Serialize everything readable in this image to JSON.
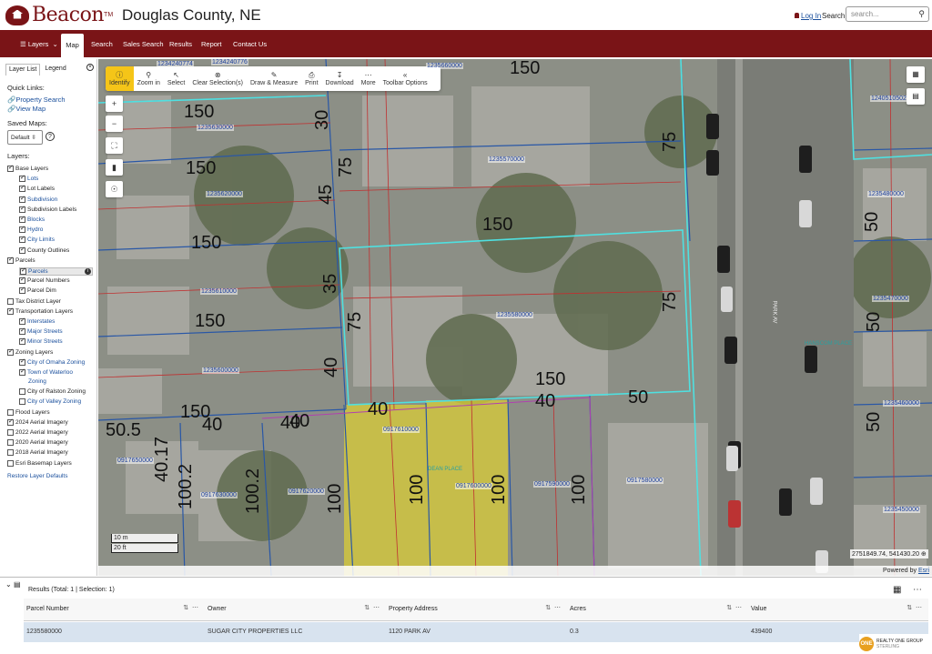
{
  "header": {
    "brand": "Beacon",
    "tm": "TM",
    "county": "Douglas County, NE",
    "login": "Log In",
    "search_link": "Search",
    "search_placeholder": "search..."
  },
  "nav": {
    "layers": "Layers",
    "map": "Map",
    "search": "Search",
    "sales_search": "Sales Search",
    "results": "Results",
    "report": "Report",
    "contact": "Contact Us"
  },
  "sidebar": {
    "tab_layer_list": "Layer List",
    "tab_legend": "Legend",
    "quick_links": "Quick Links:",
    "property_search": "Property Search",
    "view_map": "View Map",
    "saved_maps": "Saved Maps:",
    "saved_default": "Default",
    "layers_heading": "Layers:",
    "restore": "Restore Layer Defaults",
    "layers": [
      {
        "label": "Base Layers",
        "checked": true,
        "indent": 0,
        "link": false
      },
      {
        "label": "Lots",
        "checked": true,
        "indent": 1,
        "link": true
      },
      {
        "label": "Lot Labels",
        "checked": true,
        "indent": 1,
        "link": false
      },
      {
        "label": "Subdivision",
        "checked": true,
        "indent": 1,
        "link": true
      },
      {
        "label": "Subdivision Labels",
        "checked": true,
        "indent": 1,
        "link": false
      },
      {
        "label": "Blocks",
        "checked": true,
        "indent": 1,
        "link": true
      },
      {
        "label": "Hydro",
        "checked": true,
        "indent": 1,
        "link": true
      },
      {
        "label": "City Limits",
        "checked": true,
        "indent": 1,
        "link": true
      },
      {
        "label": "County Outlines",
        "checked": true,
        "indent": 1,
        "link": false
      },
      {
        "label": "Parcels",
        "checked": true,
        "indent": 0,
        "link": false
      },
      {
        "label": "Parcels",
        "checked": true,
        "indent": 1,
        "link": true,
        "highlight": true
      },
      {
        "label": "Parcel Numbers",
        "checked": true,
        "indent": 1,
        "link": false
      },
      {
        "label": "Parcel Dim",
        "checked": true,
        "indent": 1,
        "link": false
      },
      {
        "label": "Tax District Layer",
        "checked": false,
        "indent": 0,
        "link": false
      },
      {
        "label": "Transportation Layers",
        "checked": true,
        "indent": 0,
        "link": false
      },
      {
        "label": "Interstates",
        "checked": true,
        "indent": 1,
        "link": true
      },
      {
        "label": "Major Streets",
        "checked": true,
        "indent": 1,
        "link": true
      },
      {
        "label": "Minor Streets",
        "checked": true,
        "indent": 1,
        "link": true
      },
      {
        "label": "Zoning Layers",
        "checked": true,
        "indent": 0,
        "link": false
      },
      {
        "label": "City of Omaha Zoning",
        "checked": true,
        "indent": 1,
        "link": true
      },
      {
        "label": "Town of Waterloo",
        "checked": true,
        "indent": 1,
        "link": true
      },
      {
        "label": "Zoning",
        "checked": null,
        "indent": 1,
        "link": true
      },
      {
        "label": "City of Ralston Zoning",
        "checked": false,
        "indent": 1,
        "link": false
      },
      {
        "label": "City of Valley Zoning",
        "checked": false,
        "indent": 1,
        "link": true
      },
      {
        "label": "Flood Layers",
        "checked": false,
        "indent": 0,
        "link": false
      },
      {
        "label": "2024 Aerial Imagery",
        "checked": true,
        "indent": 0,
        "link": false
      },
      {
        "label": "2022 Aerial Imagery",
        "checked": false,
        "indent": 0,
        "link": false
      },
      {
        "label": "2020 Aerial Imagery",
        "checked": false,
        "indent": 0,
        "link": false
      },
      {
        "label": "2018 Aerial Imagery",
        "checked": false,
        "indent": 0,
        "link": false
      },
      {
        "label": "Esri Basemap Layers",
        "checked": false,
        "indent": 0,
        "link": false
      }
    ]
  },
  "toolbar": {
    "identify": "Identify",
    "zoom_in": "Zoom in",
    "select": "Select",
    "clear": "Clear Selection(s)",
    "draw": "Draw & Measure",
    "print": "Print",
    "download": "Download",
    "more": "More",
    "options": "Toolbar Options"
  },
  "map": {
    "scale_m": "10 m",
    "scale_ft": "20 ft",
    "coords": "2751849.74, 541430.20",
    "powered_by": "Powered by",
    "esri": "Esri",
    "labels": {
      "p1": "1235630000",
      "p2": "1235620000",
      "p3": "1235610000",
      "p4": "1235600000",
      "p5": "1235570000",
      "p6": "1235580000",
      "p7": "0917610000",
      "p8": "0917600000",
      "p9": "0917650000",
      "p10": "0917630000",
      "p11": "0917620000",
      "p12": "0917590000",
      "p13": "0917580000",
      "p14": "1235480000",
      "p15": "1235470000",
      "p16": "1235460000",
      "p17": "1235450000",
      "p18": "1240510502",
      "p19": "1235660000",
      "p20": "1234240774",
      "p21": "1234240776",
      "street1": "HANSCOM PLACE",
      "street2": "DEAN PLACE",
      "street3": "PARK AV"
    },
    "dims": [
      "150",
      "150",
      "150",
      "150",
      "150",
      "150",
      "150",
      "150",
      "30",
      "75",
      "45",
      "35",
      "40",
      "75",
      "75",
      "75",
      "40",
      "40",
      "40",
      "50",
      "100",
      "100",
      "100",
      "100",
      "100.2",
      "100.2",
      "40.17",
      "50.5",
      "50",
      "50",
      "50",
      "40",
      "40"
    ]
  },
  "results": {
    "title": "Results (Total: 1 | Selection: 1)",
    "columns": [
      "Parcel Number",
      "Owner",
      "Property Address",
      "Acres",
      "Value"
    ],
    "rows": [
      [
        "1235580000",
        "SUGAR CITY PROPERTIES LLC",
        "1120 PARK AV",
        "0.3",
        "439400"
      ]
    ],
    "brand_line1": "REALTY ONE GROUP",
    "brand_line2": "STERLING",
    "brand_mark": "ONE"
  }
}
